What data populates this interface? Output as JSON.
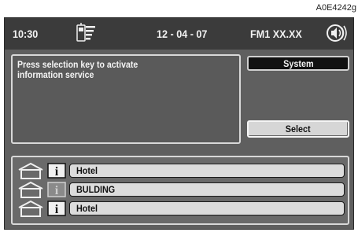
{
  "figure_code": "A0E4242g",
  "status_bar": {
    "time": "10:30",
    "date": "12 - 04 - 07",
    "radio": "FM1 XX.XX",
    "phone_icon": "phone-signal-icon",
    "sound_icon": "speaker-sound-icon"
  },
  "message": {
    "line1": "Press selection key to activate",
    "line2": "information service"
  },
  "buttons": {
    "system": "System",
    "select": "Select"
  },
  "list": {
    "items": [
      {
        "label": "Hotel",
        "info_icon": "info-icon",
        "highlighted": true
      },
      {
        "label": "BULDING",
        "info_icon": "info-icon",
        "highlighted": false
      },
      {
        "label": "Hotel",
        "info_icon": "info-icon",
        "highlighted": true
      }
    ]
  },
  "colors": {
    "screen_bg": "#5f5f5f",
    "topbar_bg": "#3b3b3b",
    "field_bg": "#dcdcdc",
    "text_light": "#f2f2f2"
  }
}
